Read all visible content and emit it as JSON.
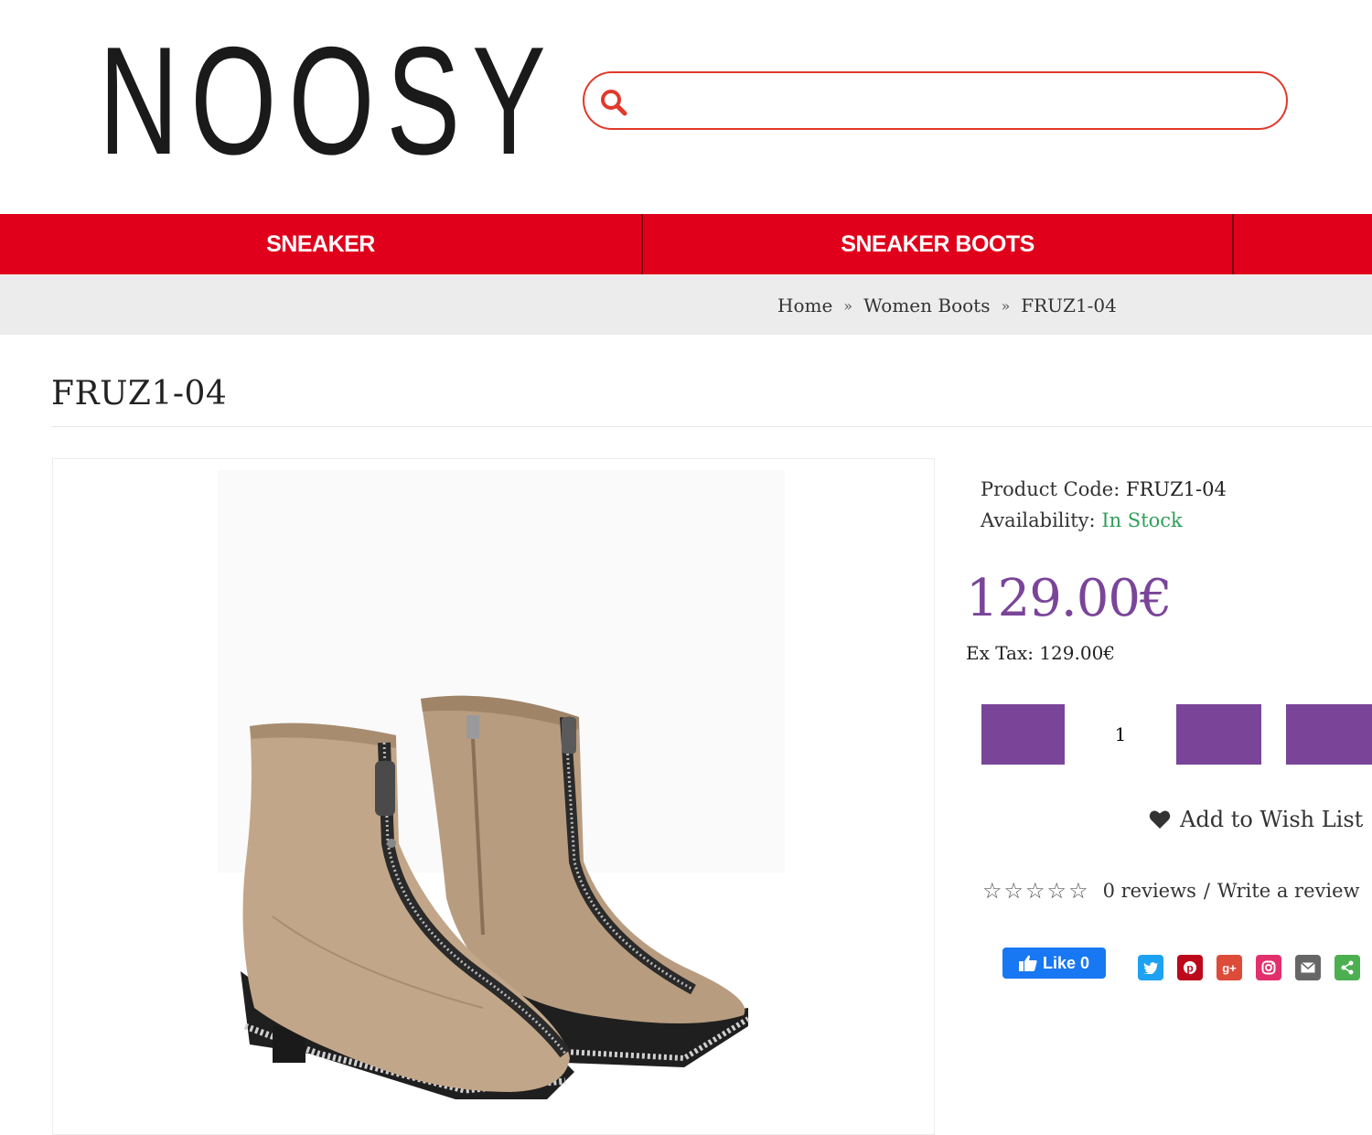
{
  "header": {
    "logo_text": "NOOSY",
    "search": {
      "value": "",
      "placeholder": ""
    }
  },
  "nav": {
    "items": [
      {
        "label": "SNEAKER"
      },
      {
        "label": "SNEAKER BOOTS"
      },
      {
        "label": ""
      }
    ]
  },
  "breadcrumb": {
    "items": [
      "Home",
      "Women Boots",
      "FRUZ1-04"
    ],
    "separator": "»"
  },
  "product": {
    "title": "FRUZ1-04",
    "code_label": "Product Code:",
    "code_value": "FRUZ1-04",
    "availability_label": "Availability:",
    "availability_value": "In Stock",
    "price": "129.00€",
    "ex_tax": "Ex Tax: 129.00€",
    "quantity": "1",
    "wishlist_label": "Add to Wish List",
    "rating_stars": 0,
    "reviews_label": "0 reviews",
    "write_review_label": "Write a review",
    "facebook_like_label": "Like 0"
  },
  "share": {
    "buttons": [
      {
        "icon": "twitter-icon",
        "color": "#1da1f2",
        "glyph": "t"
      },
      {
        "icon": "pinterest-icon",
        "color": "#bd081c",
        "glyph": "p"
      },
      {
        "icon": "google-plus-icon",
        "color": "#dd4b39",
        "glyph": "g+"
      },
      {
        "icon": "instagram-icon",
        "color": "#e1306c",
        "glyph": "◎"
      },
      {
        "icon": "email-icon",
        "color": "#666666",
        "glyph": "✉"
      },
      {
        "icon": "share-icon",
        "color": "#4caf50",
        "glyph": "<"
      }
    ]
  },
  "colors": {
    "brand_red": "#e0001b",
    "accent_purple": "#7a4599",
    "in_stock_green": "#2f9e58"
  }
}
